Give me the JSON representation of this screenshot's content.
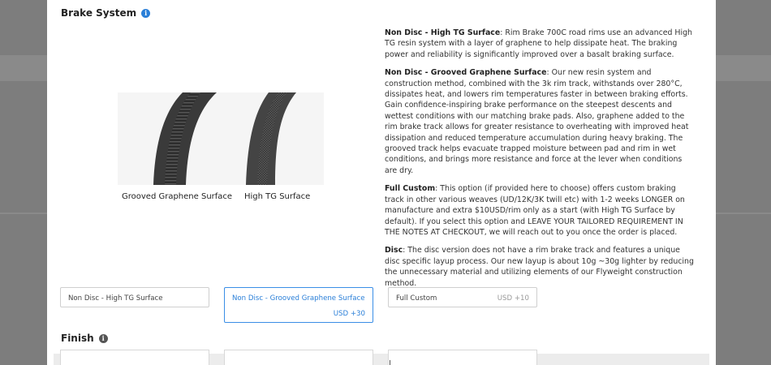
{
  "section": {
    "title": "Brake System",
    "info_icon": "info-circle-icon",
    "accent_color": "#2a7fd8"
  },
  "images": {
    "left_caption": "Grooved Graphene Surface",
    "right_caption": "High TG Surface"
  },
  "descriptions": [
    {
      "title": "Non Disc - High TG Surface",
      "body": ": Rim Brake 700C road rims use an advanced High TG resin system with a layer of graphene to help dissipate heat. The braking power and reliability is significantly improved over a basalt braking surface."
    },
    {
      "title": "Non Disc - Grooved Graphene Surface",
      "body": ": Our new resin system and construction method, combined with the 3k rim track, withstands over 280°C, dissipates heat, and lowers rim temperatures faster in between braking efforts. Gain confidence-inspiring brake performance on the steepest descents and wettest conditions with our matching brake pads. Also, graphene added to the rim brake track allows for greater resistance to overheating with improved heat dissipation and reduced temperature accumulation during heavy braking. The grooved track helps evacuate trapped moisture between pad and rim in wet conditions, and brings more resistance and force at the lever when conditions are dry."
    },
    {
      "title": "Full Custom",
      "body": ": This option (if provided here to choose) offers custom braking track in other various weaves (UD/12K/3K twill etc) with 1-2 weeks LONGER on manufacture and extra $10USD/rim only as a start (with High TG Surface by default). If you select this option and LEAVE YOUR TAILORED REQUIREMENT IN THE NOTES AT CHECKOUT, we will reach out to you once the order is placed."
    },
    {
      "title": "Disc",
      "body": ": The disc version does not have a rim brake track and features a unique disc specific layup process. Our new layup is about 10g ~30g lighter by reducing the unnecessary material and utilizing elements of our Flyweight construction method."
    }
  ],
  "options": [
    {
      "label": "Non Disc - High TG Surface",
      "price": "",
      "selected": false
    },
    {
      "label": "Non Disc - Grooved Graphene Surface",
      "price": "USD +30",
      "selected": true
    },
    {
      "label": "Full Custom",
      "price": "USD +10",
      "selected": false
    }
  ],
  "finish": {
    "title": "Finish",
    "info_icon": "info-circle-icon"
  }
}
